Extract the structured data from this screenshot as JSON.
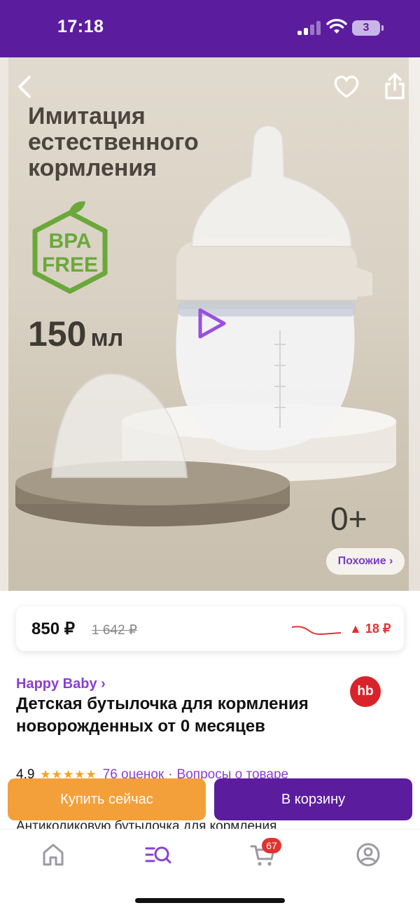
{
  "status_bar": {
    "time": "17:18",
    "battery": "3"
  },
  "hero": {
    "headline": "Имитация естественного кормления",
    "bpa_line1": "BPA",
    "bpa_line2": "FREE",
    "volume_number": "150",
    "volume_unit": "мл",
    "age": "0+",
    "similar_label": "Похожие ›"
  },
  "price": {
    "current": "850 ₽",
    "old": "1 642 ₽",
    "change": "▲ 18 ₽"
  },
  "product": {
    "brand": "Happy Baby ›",
    "brand_logo": "hb",
    "title": "Детская бутылочка для кормления новорожденных от 0 месяцев",
    "rating": "4,9",
    "stars": "★★★★★",
    "reviews": "76 оценок",
    "separator": "·",
    "questions": "Вопросы о товаре",
    "description_peek": "Антиколиковую бутылочка для кормления"
  },
  "actions": {
    "buy_now": "Купить сейчас",
    "add_to_cart": "В корзину"
  },
  "tabbar": {
    "cart_badge": "67",
    "active_color": "#8a3fcf"
  },
  "colors": {
    "brand_purple": "#5b1d9e",
    "accent_purple": "#8a3fcf",
    "buy_orange": "#f4a03a",
    "price_up_red": "#e0332f",
    "bpa_green": "#6aa83a"
  }
}
